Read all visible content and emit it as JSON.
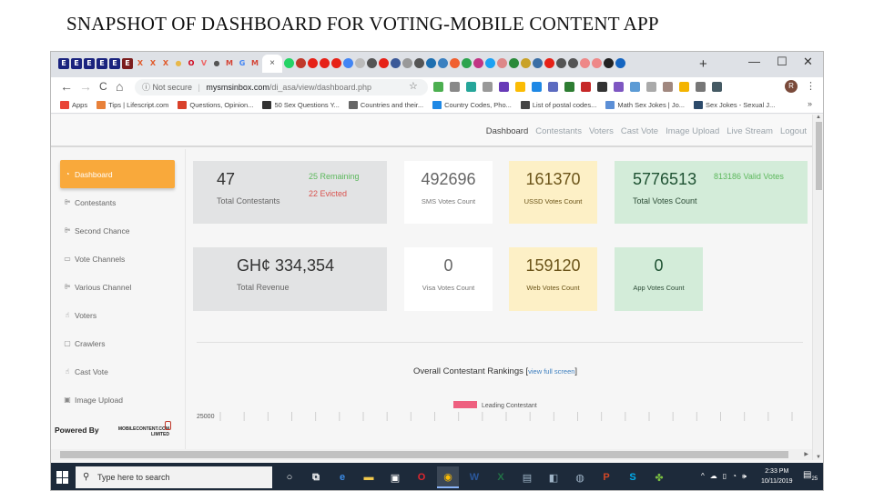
{
  "slide": {
    "title": "SNAPSHOT OF DASHBOARD FOR VOTING-MOBILE CONTENT APP"
  },
  "browser": {
    "tab_favicons": [
      {
        "icon": "e-favicon",
        "letter": "E",
        "color": "#1a237e"
      },
      {
        "icon": "e-favicon",
        "letter": "E",
        "color": "#1a237e"
      },
      {
        "icon": "e-favicon",
        "letter": "E",
        "color": "#1a237e"
      },
      {
        "icon": "e-favicon",
        "letter": "E",
        "color": "#1a237e"
      },
      {
        "icon": "e-favicon",
        "letter": "E",
        "color": "#1a237e"
      },
      {
        "icon": "e-favicon",
        "letter": "E",
        "color": "#7b1c1c"
      },
      {
        "icon": "x-favicon",
        "letter": "X",
        "color": "#e05a2b"
      },
      {
        "icon": "x-favicon",
        "letter": "X",
        "color": "#e05a2b"
      },
      {
        "icon": "x-favicon",
        "letter": "X",
        "color": "#e05a2b"
      },
      {
        "icon": "circle-favicon",
        "letter": "●",
        "color": "#e8b84a"
      },
      {
        "icon": "opera-favicon",
        "letter": "O",
        "color": "#d0021b"
      },
      {
        "icon": "vp-favicon",
        "letter": "V",
        "color": "#e66"
      },
      {
        "icon": "globe-favicon",
        "letter": "●",
        "color": "#555"
      },
      {
        "icon": "gmail-favicon",
        "letter": "M",
        "color": "#d44638"
      },
      {
        "icon": "google-favicon",
        "letter": "G",
        "color": "#4285f4"
      },
      {
        "icon": "gmail-favicon",
        "letter": "M",
        "color": "#d44638"
      }
    ],
    "active_tab_close": "×",
    "tab_favicons_right": [
      {
        "icon": "whatsapp-favicon",
        "color": "#25d366"
      },
      {
        "icon": "speed-favicon",
        "color": "#c0392b"
      },
      {
        "icon": "youtube-favicon",
        "color": "#e62117"
      },
      {
        "icon": "youtube-favicon",
        "color": "#e62117"
      },
      {
        "icon": "youtube-favicon",
        "color": "#e62117"
      },
      {
        "icon": "google-favicon",
        "color": "#4285f4"
      },
      {
        "icon": "doc-favicon",
        "color": "#bbb"
      },
      {
        "icon": "globe-favicon",
        "color": "#555"
      },
      {
        "icon": "youtube-favicon",
        "color": "#e62117"
      },
      {
        "icon": "facebook-favicon",
        "color": "#3b5998"
      },
      {
        "icon": "cart-favicon",
        "color": "#999"
      },
      {
        "icon": "globe-favicon",
        "color": "#555"
      },
      {
        "icon": "circle-favicon",
        "color": "#1e6fb0"
      },
      {
        "icon": "circle-favicon",
        "color": "#3a80c0"
      },
      {
        "icon": "link-favicon",
        "color": "#f06030"
      },
      {
        "icon": "d-favicon",
        "color": "#2da44e"
      },
      {
        "icon": "instagram-favicon",
        "color": "#c13584"
      },
      {
        "icon": "twitter-favicon",
        "color": "#1da1f2"
      },
      {
        "icon": "mail-favicon",
        "color": "#d88"
      },
      {
        "icon": "g-favicon",
        "color": "#2a8a3a"
      },
      {
        "icon": "badge-favicon",
        "color": "#c9a227"
      },
      {
        "icon": "person-favicon",
        "color": "#3a6ea5"
      },
      {
        "icon": "youtube-favicon",
        "color": "#e62117"
      },
      {
        "icon": "globe-favicon",
        "color": "#555"
      },
      {
        "icon": "globe-favicon",
        "color": "#555"
      },
      {
        "icon": "news-favicon",
        "color": "#e88"
      },
      {
        "icon": "news-favicon",
        "color": "#e88"
      },
      {
        "icon": "we-favicon",
        "color": "#222"
      },
      {
        "icon": "d-favicon",
        "color": "#1565c0"
      }
    ],
    "new_tab": "+",
    "window_controls": {
      "minimize": "—",
      "maximize": "☐",
      "close": "✕"
    },
    "nav": {
      "back": "←",
      "forward": "→",
      "reload": "C",
      "home": "⌂"
    },
    "address": {
      "security": "ⓘ Not secure",
      "separator": "|",
      "host": "mysmsinbox.com",
      "path": "/di_asa/view/dashboard.php"
    },
    "bookmark_star": "☆",
    "profile_initial": "R",
    "menu": "⋮",
    "extension_colors": [
      "#4caf50",
      "#888",
      "#26a69a",
      "#999",
      "#673ab7",
      "#fbbc04",
      "#1e88e5",
      "#5c6bc0",
      "#2e7d32",
      "#c62828",
      "#333",
      "#7e57c2",
      "#5c9bd5",
      "#aaa",
      "#a1887f",
      "#f4b400",
      "#777",
      "#455a64"
    ],
    "bookmarks": [
      {
        "label": "Apps",
        "color": "#e94235"
      },
      {
        "label": "Tips | Lifescript.com",
        "color": "#e8813a"
      },
      {
        "label": "Questions, Opinion...",
        "color": "#d9412b"
      },
      {
        "label": "50 Sex Questions Y...",
        "color": "#333"
      },
      {
        "label": "Countries and their...",
        "color": "#666"
      },
      {
        "label": "Country Codes, Pho...",
        "color": "#1e88e5"
      },
      {
        "label": "List of postal codes...",
        "color": "#444"
      },
      {
        "label": "Math Sex Jokes | Jo...",
        "color": "#5c8fd6"
      },
      {
        "label": "Sex Jokes - Sexual J...",
        "color": "#2c4a6b"
      }
    ],
    "bookmarks_more": "»"
  },
  "app": {
    "topnav": [
      "Dashboard",
      "Contestants",
      "Voters",
      "Cast Vote",
      "Image Upload",
      "Live Stream",
      "Logout"
    ],
    "sidebar": [
      {
        "label": "Dashboard",
        "icon": "pie-chart-icon",
        "glyph": "◔",
        "active": true
      },
      {
        "label": "Contestants",
        "icon": "users-icon",
        "glyph": "ꔼ"
      },
      {
        "label": "Second Chance",
        "icon": "users-icon",
        "glyph": "ꔼ"
      },
      {
        "label": "Vote Channels",
        "icon": "laptop-icon",
        "glyph": "▭"
      },
      {
        "label": "Various Channel",
        "icon": "users-icon",
        "glyph": "ꔼ"
      },
      {
        "label": "Voters",
        "icon": "thumbs-up-icon",
        "glyph": "☝"
      },
      {
        "label": "Crawlers",
        "icon": "tablet-icon",
        "glyph": "▢"
      },
      {
        "label": "Cast Vote",
        "icon": "thumbs-up-icon",
        "glyph": "☝"
      },
      {
        "label": "Image Upload",
        "icon": "image-icon",
        "glyph": "▣"
      }
    ],
    "powered_by": "Powered By",
    "logo_line1": "MOBILECONTENT.COM",
    "logo_line2": "LIMITED",
    "cards": {
      "contestants": {
        "value": "47",
        "label": "Total Contestants",
        "remaining": "25 Remaining",
        "evicted": "22 Evicted"
      },
      "sms": {
        "value": "492696",
        "label": "SMS Votes Count"
      },
      "ussd": {
        "value": "161370",
        "label": "USSD Votes Count"
      },
      "total_votes": {
        "value": "5776513",
        "label": "Total Votes Count",
        "valid": "813186 Valid Votes"
      },
      "revenue": {
        "value": "GH¢ 334,354",
        "label": "Total Revenue"
      },
      "visa": {
        "value": "0",
        "label": "Visa Votes Count"
      },
      "web": {
        "value": "159120",
        "label": "Web Votes Count"
      },
      "app": {
        "value": "0",
        "label": "App Votes Count"
      }
    },
    "colors": {
      "remaining": "#5cb85c",
      "evicted": "#d9534f",
      "accent": "#f9a93b"
    },
    "rankings": {
      "title": "Overall Contestant Rankings",
      "link_open": "[",
      "link": "view full screen",
      "link_close": "]"
    }
  },
  "chart_data": {
    "type": "bar",
    "title": "Overall Contestant Rankings",
    "legend": [
      {
        "name": "Leading Contestant",
        "color": "#ee5f7f"
      }
    ],
    "legend_position": "top-center",
    "y_tick_labels": [
      "25000"
    ],
    "x_tick_count": 25,
    "series": [
      {
        "name": "Leading Contestant",
        "values": []
      }
    ]
  },
  "taskbar": {
    "search_placeholder": "Type here to search",
    "apps": [
      {
        "name": "cortana",
        "glyph": "○",
        "color": "#1d2a3a"
      },
      {
        "name": "task-view",
        "glyph": "⧉",
        "color": "#1d2a3a"
      },
      {
        "name": "edge",
        "glyph": "e",
        "color": "#1d2a3a"
      },
      {
        "name": "file-explorer",
        "glyph": "▬",
        "color": "#1d2a3a"
      },
      {
        "name": "store",
        "glyph": "▣",
        "color": "#1d2a3a"
      },
      {
        "name": "opera",
        "glyph": "O",
        "color": "#1d2a3a"
      },
      {
        "name": "chrome",
        "glyph": "◉",
        "color": "#3b4756"
      },
      {
        "name": "word",
        "glyph": "W",
        "color": "#1d2a3a"
      },
      {
        "name": "excel",
        "glyph": "X",
        "color": "#1d2a3a"
      },
      {
        "name": "app-generic",
        "glyph": "▤",
        "color": "#1d2a3a"
      },
      {
        "name": "app-generic",
        "glyph": "◧",
        "color": "#1d2a3a"
      },
      {
        "name": "app-generic",
        "glyph": "◍",
        "color": "#1d2a3a"
      },
      {
        "name": "powerpoint",
        "glyph": "P",
        "color": "#1d2a3a"
      },
      {
        "name": "skype",
        "glyph": "S",
        "color": "#1d2a3a"
      },
      {
        "name": "clover",
        "glyph": "✤",
        "color": "#1d2a3a"
      }
    ],
    "tray": [
      "^",
      "☁",
      "▯",
      "◔",
      "🕪"
    ],
    "time": "2:33 PM",
    "date": "10/11/2019",
    "notifications": "25"
  }
}
